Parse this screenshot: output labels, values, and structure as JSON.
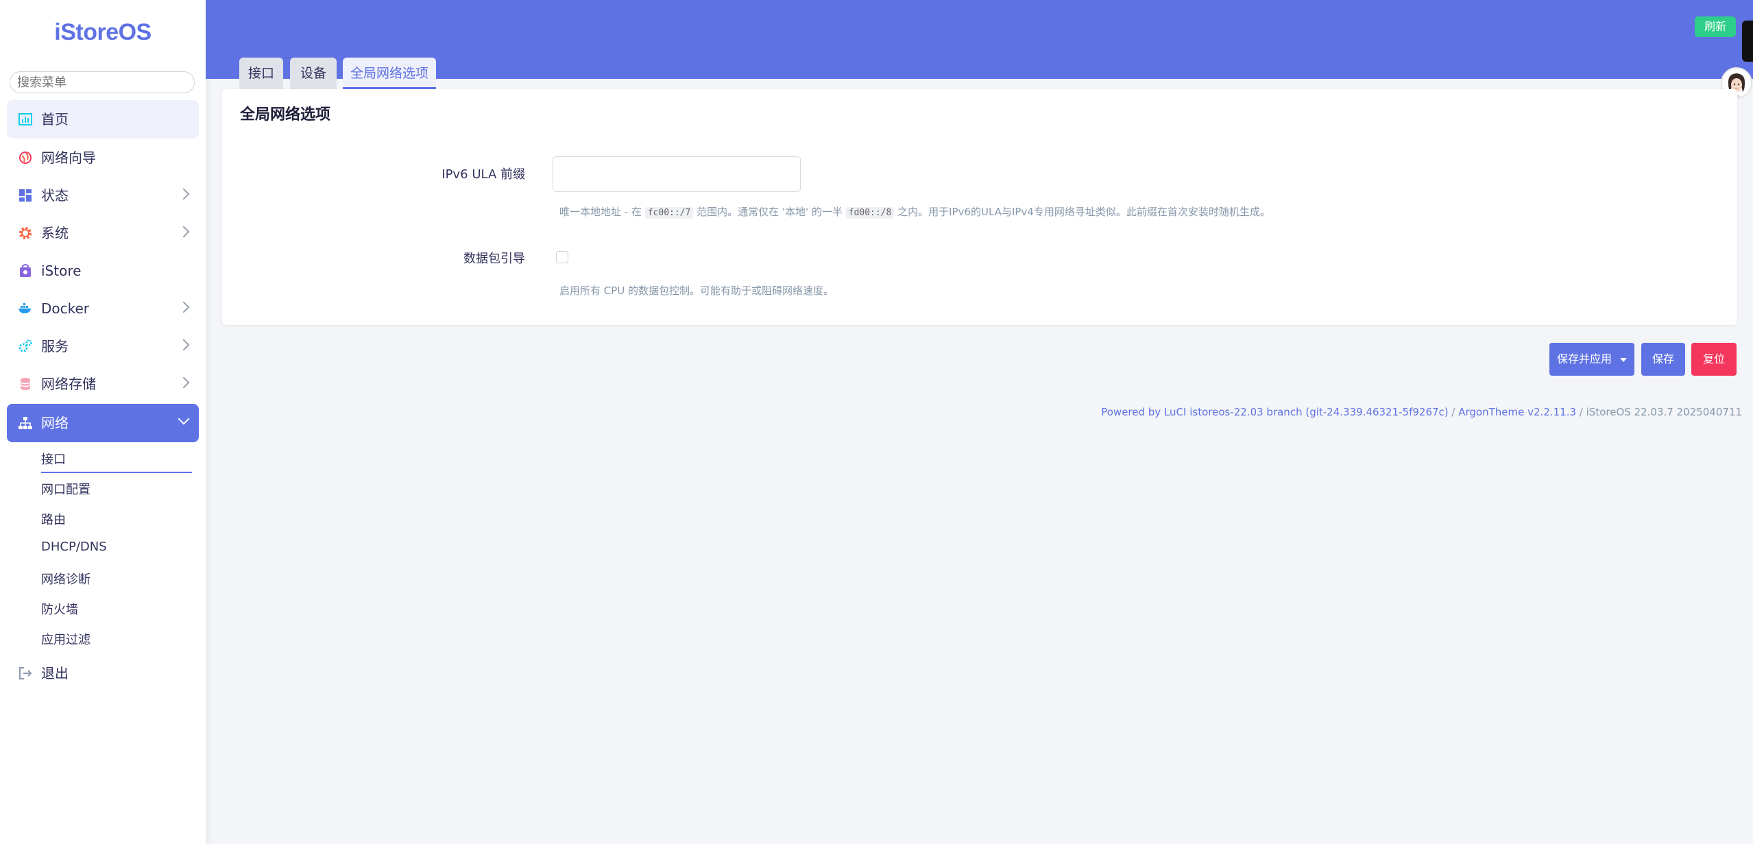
{
  "app": {
    "logo": "iStoreOS",
    "search_placeholder": "搜索菜单",
    "accent_color": "#5e72e4",
    "success_color": "#2dce89",
    "danger_color": "#f5365c"
  },
  "sidebar": {
    "items": [
      {
        "label": "首页",
        "icon": "chart-icon"
      },
      {
        "label": "网络向导",
        "icon": "globe-icon"
      },
      {
        "label": "状态",
        "icon": "dashboard-icon"
      },
      {
        "label": "系统",
        "icon": "gear-icon"
      },
      {
        "label": "iStore",
        "icon": "store-icon"
      },
      {
        "label": "Docker",
        "icon": "docker-icon"
      },
      {
        "label": "服务",
        "icon": "services-icon"
      },
      {
        "label": "网络存储",
        "icon": "database-icon"
      },
      {
        "label": "网络",
        "icon": "network-icon"
      }
    ],
    "network_subitems": [
      "接口",
      "网口配置",
      "路由",
      "DHCP/DNS",
      "网络诊断",
      "防火墙",
      "应用过滤"
    ],
    "logout": {
      "label": "退出",
      "icon": "logout-icon"
    }
  },
  "header": {
    "refresh_label": "刷新"
  },
  "tabs": [
    {
      "label": "接口"
    },
    {
      "label": "设备"
    },
    {
      "label": "全局网络选项",
      "active": true
    }
  ],
  "section": {
    "title": "全局网络选项",
    "ula": {
      "label": "IPv6 ULA 前缀",
      "value": "",
      "help_1": "唯一本地地址 - 在",
      "help_code_1": "fc00::/7",
      "help_2": "范围内。通常仅在 '本地' 的一半",
      "help_code_2": "fd00::/8",
      "help_3": "之内。用于IPv6的ULA与IPv4专用网络寻址类似。此前缀在首次安装时随机生成。"
    },
    "packet_steering": {
      "label": "数据包引导",
      "checked": false,
      "help": "启用所有 CPU 的数据包控制。可能有助于或阻碍网络速度。"
    }
  },
  "actions": {
    "save_apply": "保存并应用",
    "save": "保存",
    "reset": "复位"
  },
  "footer": {
    "luci": "Powered by LuCI istoreos-22.03 branch (git-24.339.46321-5f9267c)",
    "sep1": " / ",
    "theme": "ArgonTheme v2.2.11.3",
    "sep2": " / ",
    "version": "iStoreOS 22.03.7 2025040711"
  }
}
